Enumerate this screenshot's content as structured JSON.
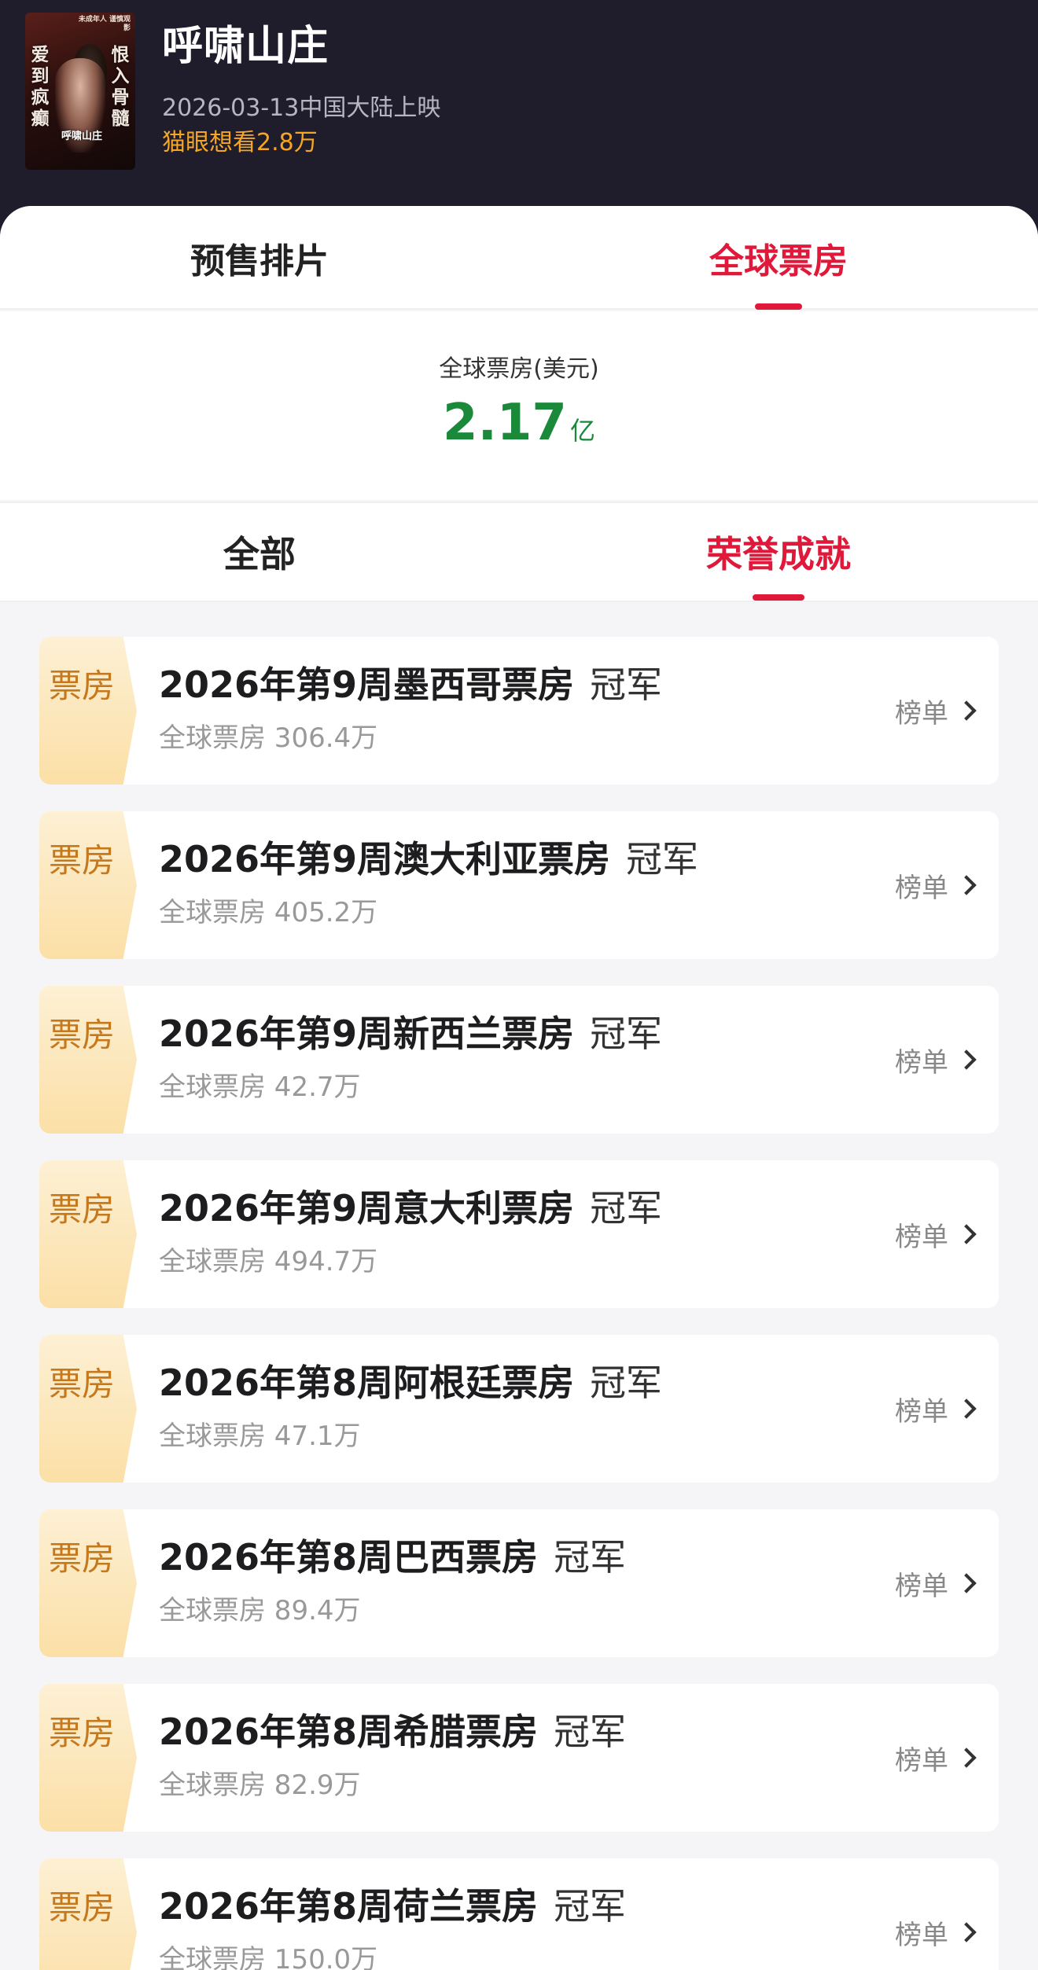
{
  "movie": {
    "title": "呼啸山庄",
    "release": "2026-03-13中国大陆上映",
    "want_to_see": "猫眼想看2.8万",
    "poster": {
      "left_text": "爱到疯癫",
      "right_text": "恨入骨髓",
      "top_text": "未成年人 谨慎观影",
      "title_text": "呼啸山庄"
    }
  },
  "main_tabs": [
    {
      "label": "预售排片",
      "active": false
    },
    {
      "label": "全球票房",
      "active": true
    }
  ],
  "gross": {
    "label": "全球票房(美元)",
    "value": "2.17",
    "unit": "亿"
  },
  "sub_tabs": [
    {
      "label": "全部",
      "active": false
    },
    {
      "label": "荣誉成就",
      "active": true
    }
  ],
  "colors": {
    "accent_red": "#e0193a",
    "gross_green": "#1a8a3a",
    "want_orange": "#f6a623",
    "badge_gold": "#fbdfa6"
  },
  "achievements": [
    {
      "badge": "票房",
      "title": "2026年第9周墨西哥票房",
      "rank": "冠军",
      "sub": "全球票房 306.4万",
      "link": "榜单"
    },
    {
      "badge": "票房",
      "title": "2026年第9周澳大利亚票房",
      "rank": "冠军",
      "sub": "全球票房 405.2万",
      "link": "榜单"
    },
    {
      "badge": "票房",
      "title": "2026年第9周新西兰票房",
      "rank": "冠军",
      "sub": "全球票房 42.7万",
      "link": "榜单"
    },
    {
      "badge": "票房",
      "title": "2026年第9周意大利票房",
      "rank": "冠军",
      "sub": "全球票房 494.7万",
      "link": "榜单"
    },
    {
      "badge": "票房",
      "title": "2026年第8周阿根廷票房",
      "rank": "冠军",
      "sub": "全球票房 47.1万",
      "link": "榜单"
    },
    {
      "badge": "票房",
      "title": "2026年第8周巴西票房",
      "rank": "冠军",
      "sub": "全球票房 89.4万",
      "link": "榜单"
    },
    {
      "badge": "票房",
      "title": "2026年第8周希腊票房",
      "rank": "冠军",
      "sub": "全球票房 82.9万",
      "link": "榜单"
    },
    {
      "badge": "票房",
      "title": "2026年第8周荷兰票房",
      "rank": "冠军",
      "sub": "全球票房 150.0万",
      "link": "榜单"
    }
  ]
}
